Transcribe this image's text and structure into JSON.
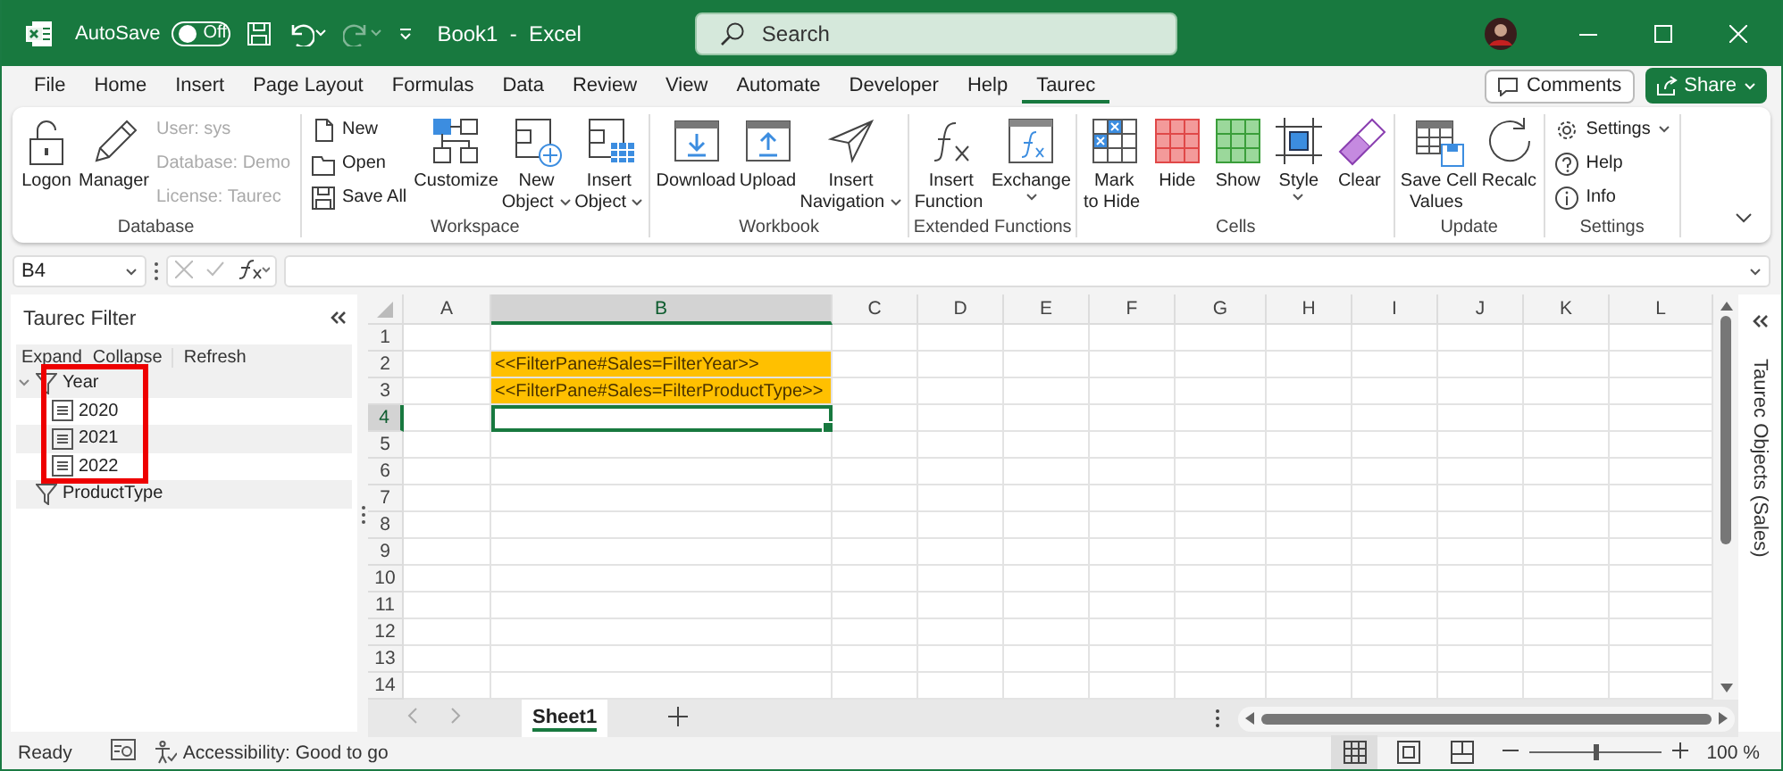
{
  "title_bar": {
    "autosave_label": "AutoSave",
    "autosave": {
      "on": false,
      "label": "Off"
    },
    "redo": {
      "disabled": true
    },
    "title": "Book1  -  Excel",
    "search": {
      "placeholder": "Search"
    }
  },
  "menu_tabs": [
    {
      "label": "File",
      "selected": false
    },
    {
      "label": "Home",
      "selected": false
    },
    {
      "label": "Insert",
      "selected": false
    },
    {
      "label": "Page Layout",
      "selected": false
    },
    {
      "label": "Formulas",
      "selected": false
    },
    {
      "label": "Data",
      "selected": false
    },
    {
      "label": "Review",
      "selected": false
    },
    {
      "label": "View",
      "selected": false
    },
    {
      "label": "Automate",
      "selected": false
    },
    {
      "label": "Developer",
      "selected": false
    },
    {
      "label": "Help",
      "selected": false
    },
    {
      "label": "Taurec",
      "selected": true
    }
  ],
  "comments_button": "Comments",
  "share_button": "Share",
  "ribbon": {
    "groups": [
      {
        "label": "Database",
        "items": [
          {
            "kind": "large",
            "label": "Logon",
            "dropdown": false
          },
          {
            "kind": "large",
            "label": "Manager",
            "dropdown": false
          },
          {
            "kind": "stack",
            "items": [
              {
                "label": "User: sys",
                "disabled": true,
                "dropdown": false
              },
              {
                "label": "Database: Demo",
                "disabled": true,
                "dropdown": false
              },
              {
                "label": "License: Taurec",
                "disabled": true,
                "dropdown": false
              }
            ]
          }
        ]
      },
      {
        "label": "Workspace",
        "items": [
          {
            "kind": "stack",
            "items": [
              {
                "label": "New",
                "disabled": false,
                "dropdown": false
              },
              {
                "label": "Open",
                "disabled": false,
                "dropdown": false
              },
              {
                "label": "Save All",
                "disabled": false,
                "dropdown": false
              }
            ]
          },
          {
            "kind": "large",
            "label": "Customize",
            "dropdown": false
          },
          {
            "kind": "large",
            "label": "New\nObject",
            "dropdown": true
          },
          {
            "kind": "large",
            "label": "Insert\nObject",
            "dropdown": true
          }
        ]
      },
      {
        "label": "Workbook",
        "items": [
          {
            "kind": "large",
            "label": "Download",
            "dropdown": false
          },
          {
            "kind": "large",
            "label": "Upload",
            "dropdown": false
          },
          {
            "kind": "large",
            "label": "Insert\nNavigation",
            "dropdown": true
          }
        ]
      },
      {
        "label": "Extended Functions",
        "items": [
          {
            "kind": "large",
            "label": "Insert\nFunction",
            "dropdown": false
          },
          {
            "kind": "large",
            "label": "Exchange",
            "dropdown": true
          }
        ]
      },
      {
        "label": "Cells",
        "items": [
          {
            "kind": "large",
            "label": "Mark\nto Hide",
            "dropdown": false
          },
          {
            "kind": "large",
            "label": "Hide",
            "dropdown": false
          },
          {
            "kind": "large",
            "label": "Show",
            "dropdown": false
          },
          {
            "kind": "large",
            "label": "Style",
            "dropdown": true
          },
          {
            "kind": "large",
            "label": "Clear",
            "dropdown": false
          }
        ]
      },
      {
        "label": "Update",
        "items": [
          {
            "kind": "large",
            "label": "Save Cell\nValues",
            "dropdown": false
          },
          {
            "kind": "large",
            "label": "Recalc",
            "dropdown": false
          }
        ]
      },
      {
        "label": "Settings",
        "items": [
          {
            "kind": "stack",
            "items": [
              {
                "label": "Settings",
                "disabled": false,
                "dropdown": true
              },
              {
                "label": "Help",
                "disabled": false,
                "dropdown": false
              },
              {
                "label": "Info",
                "disabled": false,
                "dropdown": false
              }
            ]
          }
        ]
      }
    ]
  },
  "formula_bar": {
    "name_box": "B4"
  },
  "filter_pane": {
    "title": "Taurec Filter",
    "toolbar": [
      "Expand",
      "Collapse",
      "Refresh"
    ],
    "tree": [
      {
        "label": "Year",
        "expanded": true,
        "children": [
          {
            "label": "2020"
          },
          {
            "label": "2021"
          },
          {
            "label": "2022"
          }
        ]
      },
      {
        "label": "ProductType"
      }
    ]
  },
  "sheet": {
    "columns": [
      {
        "label": "A",
        "selected": false
      },
      {
        "label": "B",
        "selected": true
      },
      {
        "label": "C",
        "selected": false
      },
      {
        "label": "D",
        "selected": false
      },
      {
        "label": "E",
        "selected": false
      },
      {
        "label": "F",
        "selected": false
      },
      {
        "label": "G",
        "selected": false
      },
      {
        "label": "H",
        "selected": false
      },
      {
        "label": "I",
        "selected": false
      },
      {
        "label": "J",
        "selected": false
      },
      {
        "label": "K",
        "selected": false
      },
      {
        "label": "L",
        "selected": false
      }
    ],
    "rows": [
      {
        "label": "1",
        "selected": false
      },
      {
        "label": "2",
        "selected": false,
        "column_b": {
          "text": "<<FilterPane#Sales=FilterYear>>",
          "highlighted": true,
          "active": false
        }
      },
      {
        "label": "3",
        "selected": false,
        "column_b": {
          "text": "<<FilterPane#Sales=FilterProductType>>",
          "highlighted": true,
          "active": false
        }
      },
      {
        "label": "4",
        "selected": true,
        "column_b": {
          "highlighted": false,
          "active": true
        }
      },
      {
        "label": "5",
        "selected": false
      },
      {
        "label": "6",
        "selected": false
      },
      {
        "label": "7",
        "selected": false
      },
      {
        "label": "8",
        "selected": false
      },
      {
        "label": "9",
        "selected": false
      },
      {
        "label": "10",
        "selected": false
      },
      {
        "label": "11",
        "selected": false
      },
      {
        "label": "12",
        "selected": false
      },
      {
        "label": "13",
        "selected": false
      },
      {
        "label": "14",
        "selected": false
      }
    ]
  },
  "objects_pane": {
    "title": "Taurec Objects (Sales)"
  },
  "sheet_tabs": [
    {
      "label": "Sheet1",
      "selected": true
    }
  ],
  "status_bar": {
    "status": "Ready",
    "accessibility": "Accessibility: Good to go",
    "views": [
      {
        "selected": true
      },
      {
        "selected": false
      },
      {
        "selected": false
      }
    ],
    "zoom": {
      "level": 0.5,
      "label": "100 %"
    }
  }
}
